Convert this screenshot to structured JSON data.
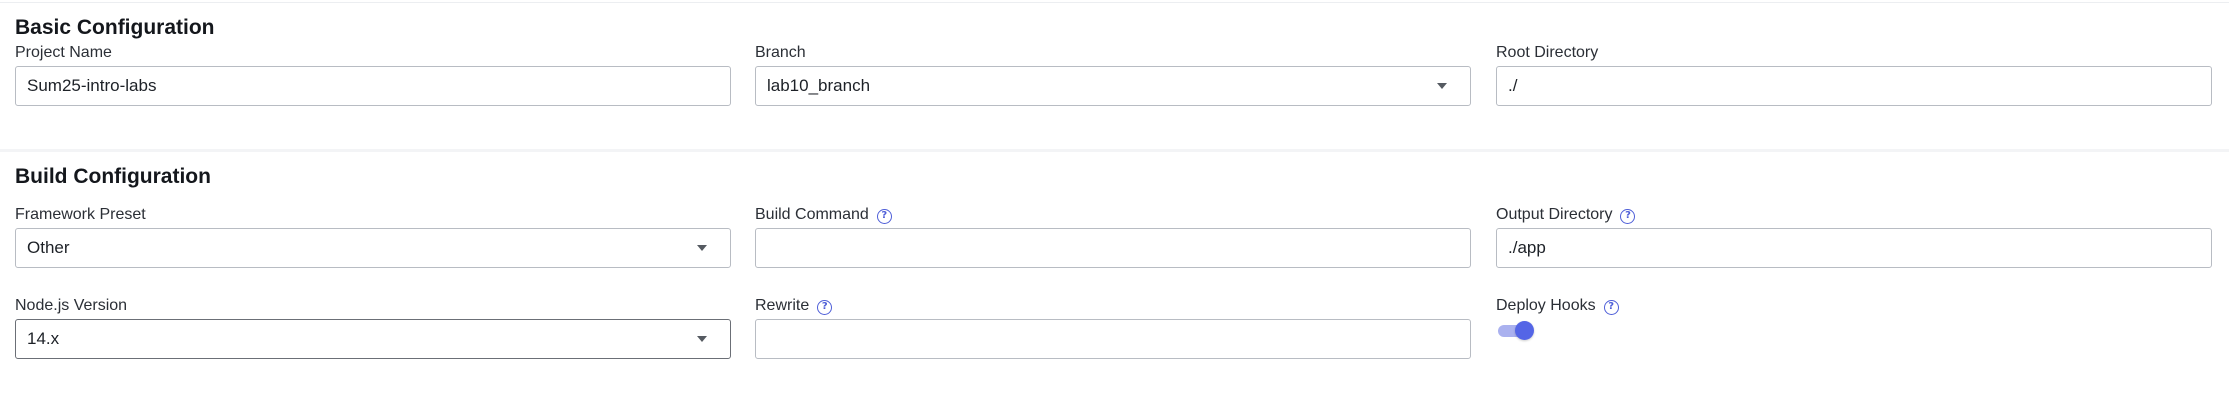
{
  "basic": {
    "title": "Basic Configuration",
    "project_name": {
      "label": "Project Name",
      "value": "Sum25-intro-labs"
    },
    "branch": {
      "label": "Branch",
      "value": "lab10_branch",
      "icon": "chevron-down-icon"
    },
    "root_directory": {
      "label": "Root Directory",
      "value": "./"
    }
  },
  "build": {
    "title": "Build Configuration",
    "framework_preset": {
      "label": "Framework Preset",
      "value": "Other",
      "icon": "chevron-down-icon"
    },
    "build_command": {
      "label": "Build Command",
      "value": "",
      "help_icon": "help-icon"
    },
    "output_directory": {
      "label": "Output Directory",
      "value": "./app",
      "help_icon": "help-icon"
    },
    "node_version": {
      "label": "Node.js Version",
      "value": "14.x",
      "icon": "chevron-down-icon"
    },
    "rewrite": {
      "label": "Rewrite",
      "value": "",
      "help_icon": "help-icon"
    },
    "deploy_hooks": {
      "label": "Deploy Hooks",
      "enabled": true,
      "help_icon": "help-icon"
    }
  },
  "colors": {
    "accent": "#5465e6",
    "accent_light": "#aab1ef",
    "border": "#b8bcc3",
    "text": "#1d2127"
  }
}
